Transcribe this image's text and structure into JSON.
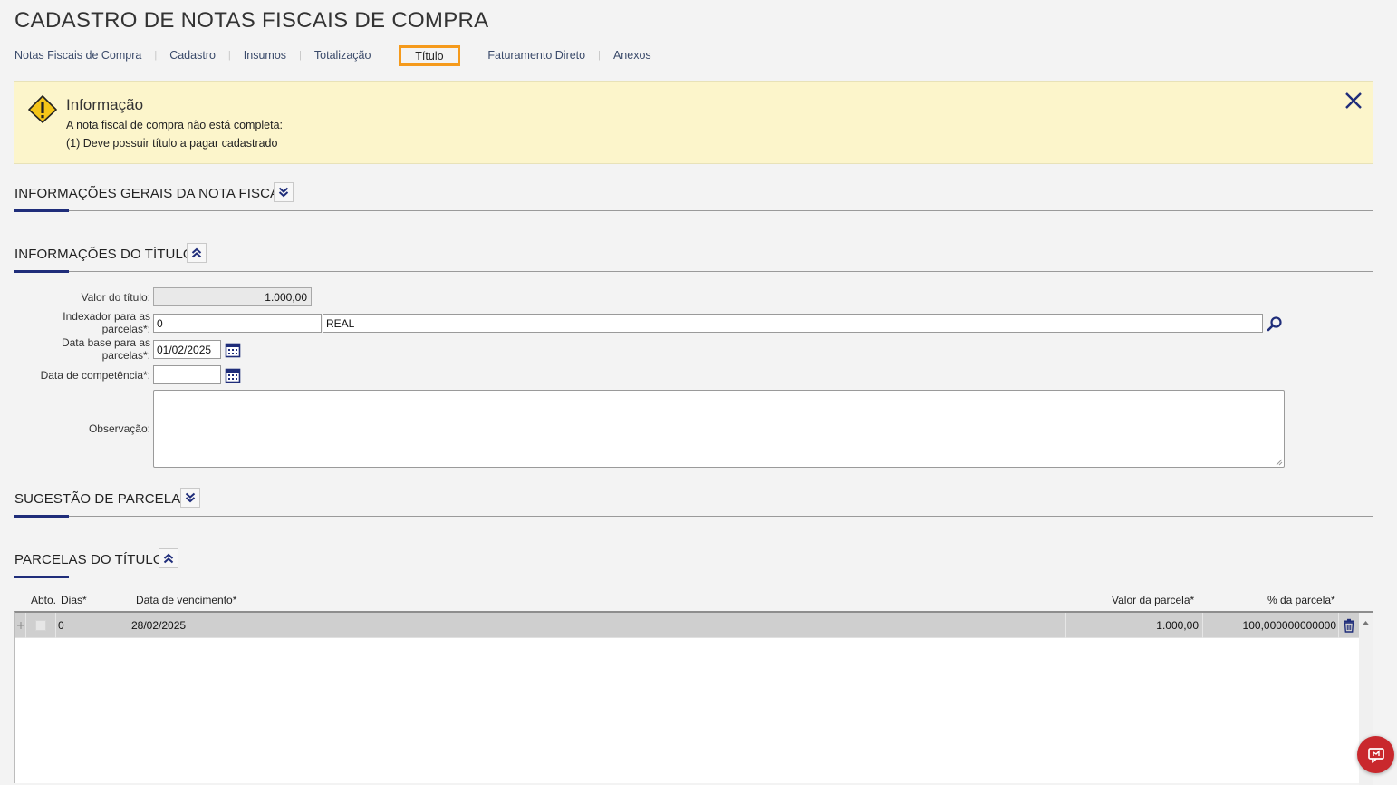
{
  "page": {
    "title": "CADASTRO DE NOTAS FISCAIS DE COMPRA"
  },
  "tabs": [
    {
      "label": "Notas Fiscais de Compra"
    },
    {
      "label": "Cadastro"
    },
    {
      "label": "Insumos"
    },
    {
      "label": "Totalização"
    },
    {
      "label": "Título",
      "active": true
    },
    {
      "label": "Faturamento Direto"
    },
    {
      "label": "Anexos"
    }
  ],
  "alert": {
    "title": "Informação",
    "line1": "A nota fiscal de compra não está completa:",
    "line2": "(1) Deve possuir título a pagar cadastrado",
    "icon": "warning-icon",
    "close_icon": "close-icon"
  },
  "sections": {
    "general": {
      "title": "INFORMAÇÕES GERAIS DA NOTA FISCAL",
      "expanded": false
    },
    "title_info": {
      "title": "INFORMAÇÕES DO TÍTULO",
      "expanded": true
    },
    "suggestion": {
      "title": "SUGESTÃO DE PARCELAS",
      "expanded": false
    },
    "installments": {
      "title": "PARCELAS DO TÍTULO",
      "expanded": true
    }
  },
  "form": {
    "valor_titulo": {
      "label": "Valor do título:",
      "value": "1.000,00"
    },
    "indexador": {
      "label_1": "Indexador para as",
      "label_2": "parcelas*:",
      "code": "0",
      "description": "REAL"
    },
    "data_base": {
      "label_1": "Data base para as",
      "label_2": "parcelas*:",
      "value": "01/02/2025"
    },
    "data_competencia": {
      "label": "Data de competência*:",
      "value": ""
    },
    "observacao": {
      "label": "Observação:",
      "value": ""
    }
  },
  "grid": {
    "columns": [
      "Abto.",
      "Dias*",
      "Data de vencimento*",
      "Valor da parcela*",
      "% da parcela*"
    ],
    "rows": [
      {
        "abto": false,
        "dias": "0",
        "vencimento": "28/02/2025",
        "valor": "1.000,00",
        "percentual": "100,000000000000"
      }
    ]
  },
  "colors": {
    "accent": "#1f2d7a",
    "highlight": "#f59a1b",
    "alert_bg": "#fcf5cb",
    "fab": "#c9282d"
  }
}
